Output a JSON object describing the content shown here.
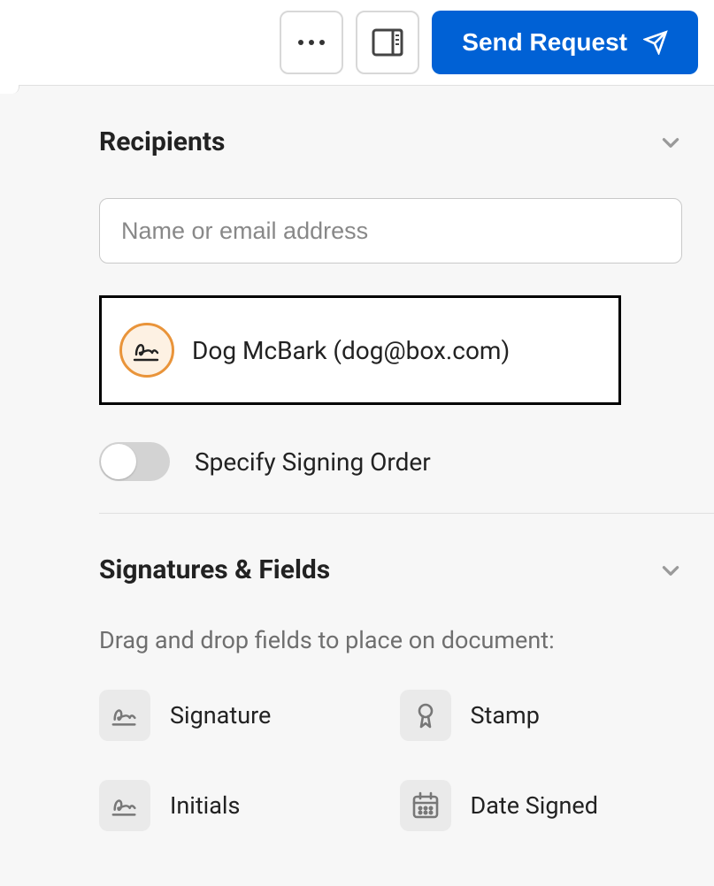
{
  "toolbar": {
    "send_label": "Send Request"
  },
  "recipients": {
    "title": "Recipients",
    "input_placeholder": "Name or email address",
    "items": [
      {
        "display": "Dog McBark (dog@box.com)"
      }
    ],
    "signing_order_label": "Specify Signing Order"
  },
  "signatures": {
    "title": "Signatures & Fields",
    "hint": "Drag and drop fields to place on document:",
    "fields": [
      {
        "label": "Signature",
        "icon": "signature-icon"
      },
      {
        "label": "Stamp",
        "icon": "stamp-icon"
      },
      {
        "label": "Initials",
        "icon": "initials-icon"
      },
      {
        "label": "Date Signed",
        "icon": "date-signed-icon"
      }
    ]
  }
}
